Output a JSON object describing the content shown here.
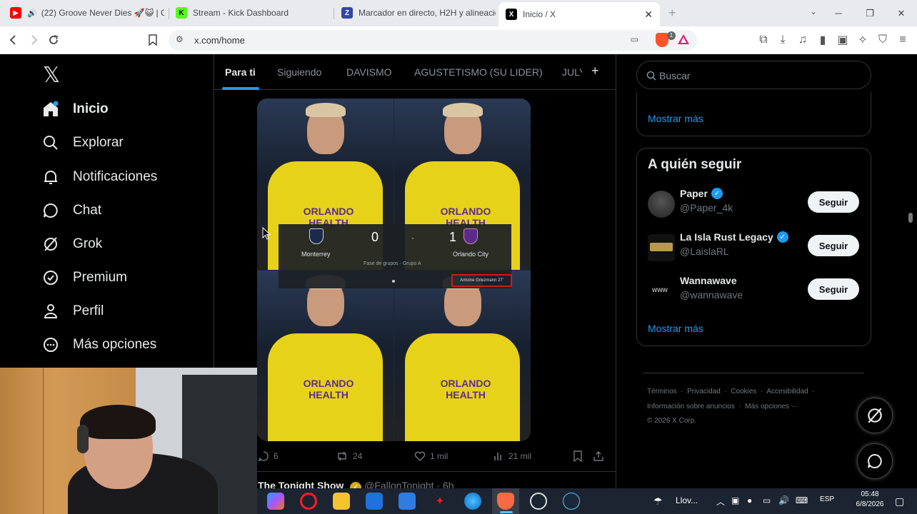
{
  "browser": {
    "tabs": [
      {
        "label": "(22) Groove Never Dies 🚀😺 | C",
        "favicon": "youtube-icon",
        "color": "#ff0000"
      },
      {
        "label": "Stream - Kick Dashboard",
        "favicon": "kick-icon",
        "color": "#53fc18"
      },
      {
        "label": "Marcador en directo, H2H y alineacio",
        "favicon": "flashscore-icon",
        "color": "#3545a8"
      },
      {
        "label": "Inicio / X",
        "favicon": "x-icon",
        "color": "#000000"
      }
    ],
    "url": "x.com/home",
    "shield_count": "1"
  },
  "nav": {
    "items": [
      {
        "label": "Inicio",
        "icon": "home-icon",
        "active": true
      },
      {
        "label": "Explorar",
        "icon": "search-icon"
      },
      {
        "label": "Notificaciones",
        "icon": "bell-icon"
      },
      {
        "label": "Chat",
        "icon": "chat-icon"
      },
      {
        "label": "Grok",
        "icon": "grok-icon"
      },
      {
        "label": "Premium",
        "icon": "premium-icon"
      },
      {
        "label": "Perfil",
        "icon": "person-icon"
      },
      {
        "label": "Más opciones",
        "icon": "more-icon"
      }
    ]
  },
  "feed": {
    "tabs": [
      "Para ti",
      "Siguiendo",
      "DAVISMO",
      "AGUSTETISMO (SU LIDER)",
      "JULY"
    ],
    "add_label": "+",
    "post": {
      "image_text": {
        "home_team": "Monterrey",
        "away_team": "Orlando City",
        "home_score": "0",
        "separator": "-",
        "away_score": "1",
        "stage": "Fase de grupos · Grupo A",
        "scorer": "Antoine Griezmann 27'",
        "sponsor": "ORLANDO HEALTH"
      },
      "replies": "6",
      "reposts": "24",
      "likes": "1 mil",
      "views": "21 mil"
    },
    "next_post": {
      "name": "The Tonight Show",
      "handle": "@FallonTonight · 6h"
    }
  },
  "sidebar": {
    "search_placeholder": "Buscar",
    "show_more_1": "Mostrar más",
    "who_to_follow_title": "A quién seguir",
    "accounts": [
      {
        "name": "Paper",
        "handle": "@Paper_4k",
        "verified": true,
        "button": "Seguir"
      },
      {
        "name": "La Isla Rust Legacy",
        "handle": "@LaislaRL",
        "verified": true,
        "button": "Seguir"
      },
      {
        "name": "Wannawave",
        "handle": "@wannawave",
        "verified": false,
        "button": "Seguir"
      }
    ],
    "show_more_2": "Mostrar más",
    "footer": {
      "links_1": [
        "Términos",
        "Privacidad",
        "Cookies",
        "Accesibilidad"
      ],
      "links_2": [
        "Información sobre anuncios",
        "Más opciones ···"
      ],
      "copyright": "© 2026 X Corp."
    }
  },
  "taskbar": {
    "weather": "Llov...",
    "language": "ESP",
    "time": "05:48",
    "date": "6/8/2026"
  }
}
